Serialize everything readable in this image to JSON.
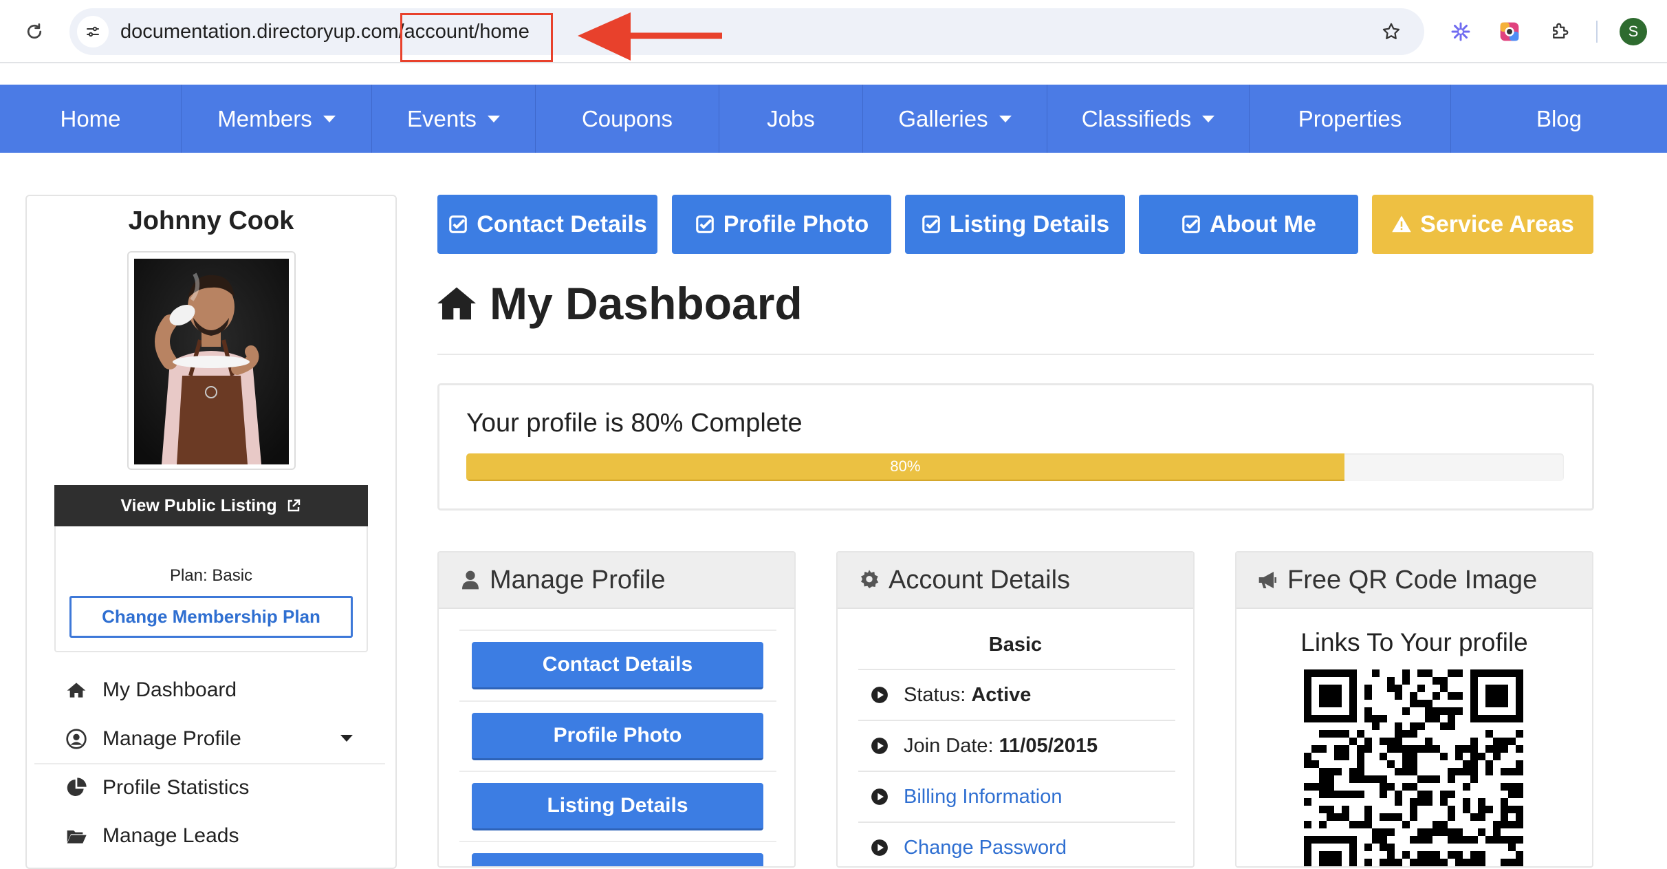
{
  "browser": {
    "url_host": "documentation.directoryup.com",
    "url_path": "/account/home",
    "profile_initial": "S"
  },
  "nav": {
    "items": [
      {
        "label": "Home",
        "dropdown": false
      },
      {
        "label": "Members",
        "dropdown": true
      },
      {
        "label": "Events",
        "dropdown": true
      },
      {
        "label": "Coupons",
        "dropdown": false
      },
      {
        "label": "Jobs",
        "dropdown": false
      },
      {
        "label": "Galleries",
        "dropdown": true
      },
      {
        "label": "Classifieds",
        "dropdown": true
      },
      {
        "label": "Properties",
        "dropdown": false
      },
      {
        "label": "Blog",
        "dropdown": false
      }
    ]
  },
  "sidebar": {
    "user_name": "Johnny Cook",
    "view_listing_label": "View Public Listing",
    "plan_label": "Plan: Basic",
    "change_plan_label": "Change Membership Plan",
    "links": [
      {
        "label": "My Dashboard",
        "icon": "home-icon"
      },
      {
        "label": "Manage Profile",
        "icon": "user-circle-icon"
      },
      {
        "label": "Profile Statistics",
        "icon": "pie-chart-icon"
      },
      {
        "label": "Manage Leads",
        "icon": "folder-open-icon"
      }
    ]
  },
  "top_buttons": [
    {
      "label": "Contact Details",
      "icon": "check-square-icon",
      "color": "#3c7de3"
    },
    {
      "label": "Profile Photo",
      "icon": "check-square-icon",
      "color": "#3c7de3"
    },
    {
      "label": "Listing Details",
      "icon": "check-square-icon",
      "color": "#3c7de3"
    },
    {
      "label": "About Me",
      "icon": "check-square-icon",
      "color": "#3c7de3"
    },
    {
      "label": "Service Areas",
      "icon": "warning-icon",
      "color": "#eec042"
    }
  ],
  "dashboard": {
    "title": "My Dashboard",
    "progress_text": "Your profile is 80% Complete",
    "progress_value": 80,
    "progress_label": "80%"
  },
  "manage_profile": {
    "title": "Manage Profile",
    "buttons": [
      "Contact Details",
      "Profile Photo",
      "Listing Details"
    ]
  },
  "account_details": {
    "title": "Account Details",
    "plan": "Basic",
    "status_label": "Status:",
    "status_value": "Active",
    "join_label": "Join Date:",
    "join_value": "11/05/2015",
    "billing_label": "Billing Information",
    "password_label": "Change Password"
  },
  "qr": {
    "title": "Free QR Code Image",
    "caption": "Links To Your profile"
  },
  "colors": {
    "nav": "#4b7be5",
    "primary": "#3c7de3",
    "warning": "#eec042",
    "progress": "#ebc142",
    "highlight_red": "#e8412c"
  }
}
